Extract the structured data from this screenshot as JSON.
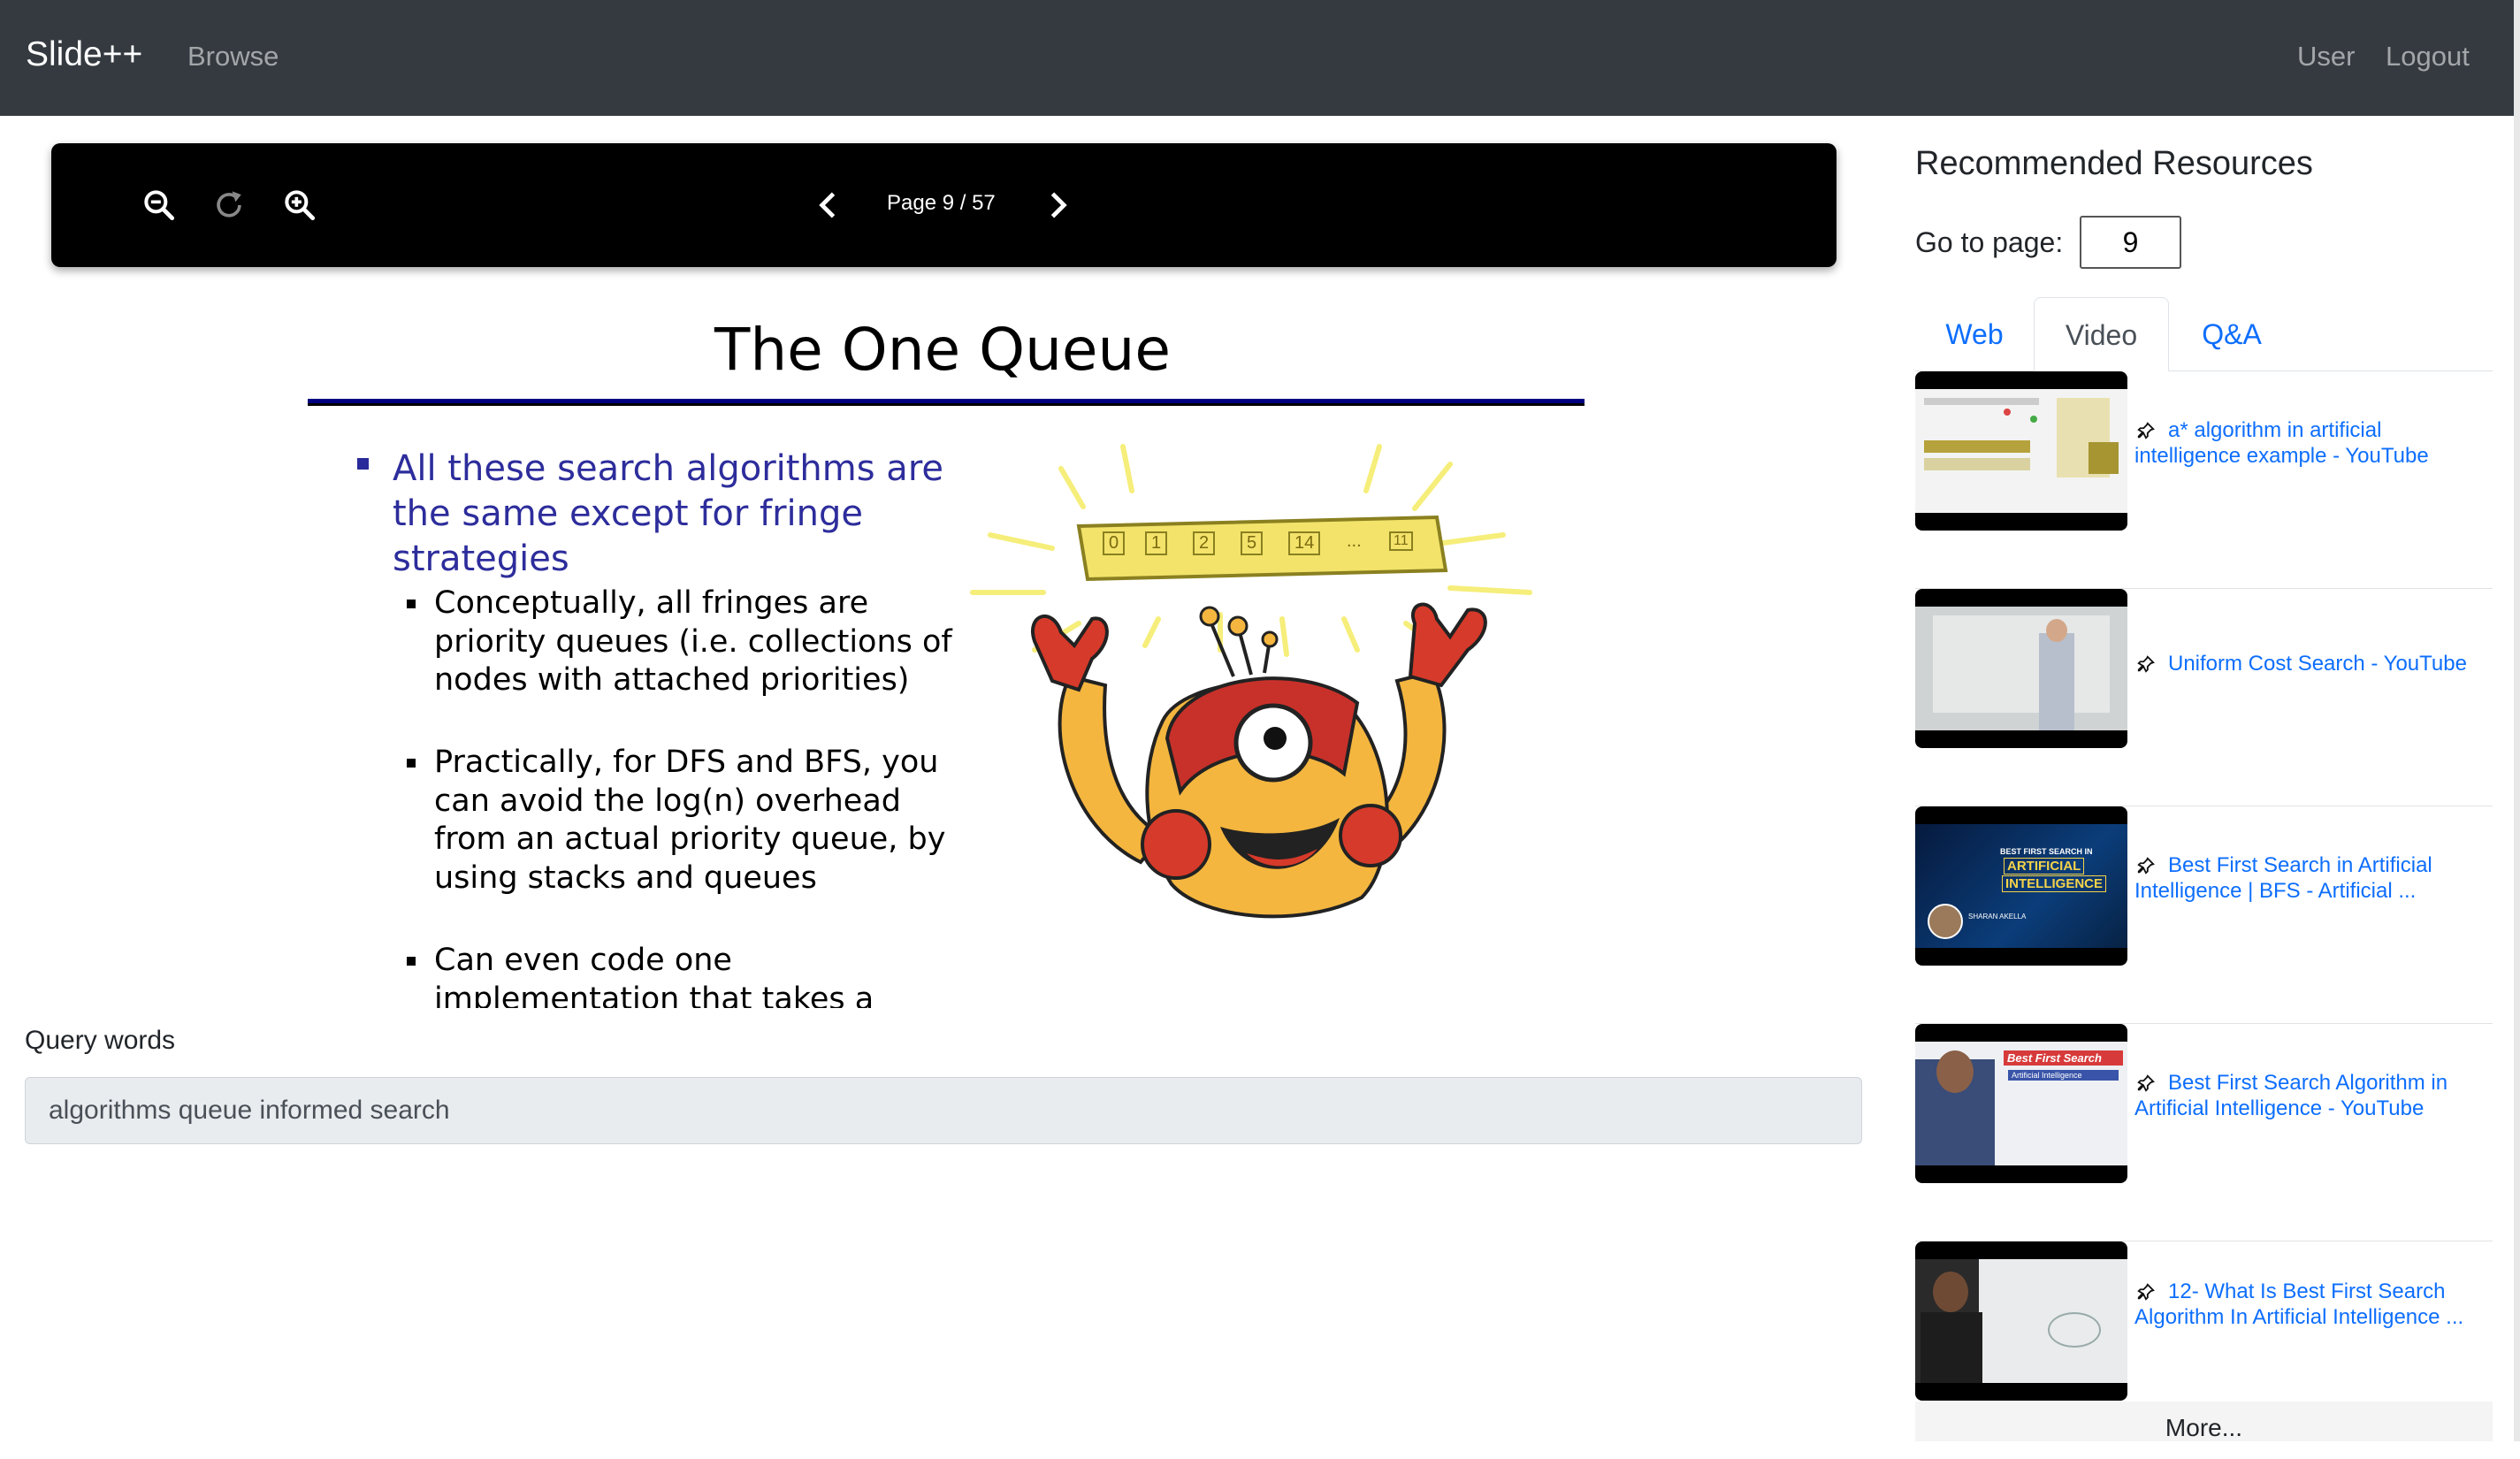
{
  "navbar": {
    "brand": "Slide++",
    "browse": "Browse",
    "user": "User",
    "logout": "Logout"
  },
  "viewer": {
    "page_indicator": "Page 9 / 57",
    "icons": [
      "zoom-out-icon",
      "rotate-icon",
      "zoom-in-icon",
      "chevron-left-icon",
      "chevron-right-icon"
    ]
  },
  "slide": {
    "title": "The One Queue",
    "main_bullet": "All these search algorithms are the same except for fringe strategies",
    "sub_bullets": [
      "Conceptually, all fringes are priority queues (i.e. collections of nodes with attached priorities)",
      "Practically, for DFS and BFS, you can avoid the log(n) overhead from an actual priority queue, by using stacks and queues",
      "Can even code one implementation that takes a"
    ],
    "queue_cells": [
      "0",
      "1",
      "2",
      "5",
      "14",
      "...",
      "11"
    ]
  },
  "query": {
    "label": "Query words",
    "value": "algorithms queue informed search"
  },
  "recommendations": {
    "title": "Recommended Resources",
    "goto_label": "Go to page:",
    "goto_value": "9",
    "tabs": [
      {
        "label": "Web",
        "active": false
      },
      {
        "label": "Video",
        "active": true
      },
      {
        "label": "Q&A",
        "active": false
      }
    ],
    "videos": [
      {
        "title": "a* algorithm in artificial intelligence example - YouTube"
      },
      {
        "title": "Uniform Cost Search - YouTube"
      },
      {
        "title": "Best First Search in Artificial Intelligence | BFS - Artificial ..."
      },
      {
        "title": "Best First Search Algorithm in Artificial Intelligence - YouTube"
      },
      {
        "title": "12- What Is Best First Search Algorithm In Artificial Intelligence ..."
      }
    ],
    "thumb_texts": {
      "v3_line1": "BEST FIRST SEARCH IN",
      "v3_line2": "ARTIFICIAL",
      "v3_line3": "INTELLIGENCE",
      "v3_name": "SHARAN AKELLA",
      "v4_line1": "Best First Search",
      "v4_line2": "Artificial Intelligence"
    },
    "more": "More..."
  },
  "colors": {
    "navbar": "#343a40",
    "link": "#0d6efd",
    "slide_bullet": "#2d2d9c"
  }
}
